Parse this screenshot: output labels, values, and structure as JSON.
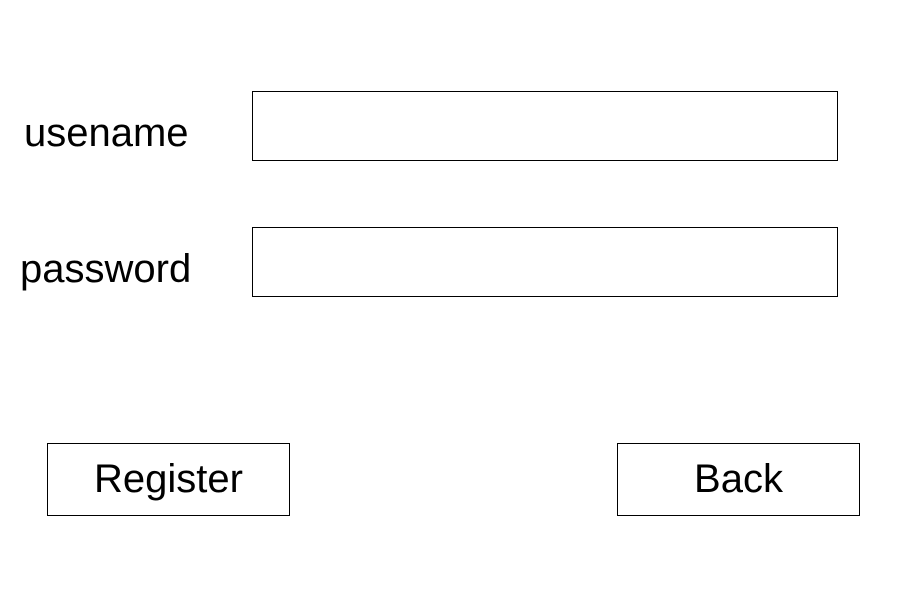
{
  "form": {
    "username": {
      "label": "usename",
      "value": ""
    },
    "password": {
      "label": "password",
      "value": ""
    }
  },
  "actions": {
    "register_label": "Register",
    "back_label": "Back"
  }
}
